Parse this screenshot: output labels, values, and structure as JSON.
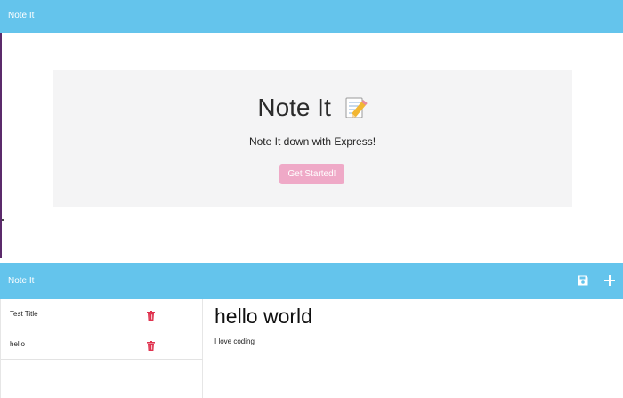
{
  "landing": {
    "brand": "Note It",
    "hero_title": "Note It",
    "hero_icon": "memo-pencil-icon",
    "subtitle": "Note It down with Express!",
    "cta_label": "Get Started!"
  },
  "app": {
    "brand": "Note It",
    "toolbar": {
      "save_icon": "save-icon",
      "new_note_icon": "plus-icon"
    },
    "notes": [
      {
        "title": "Test Title"
      },
      {
        "title": "hello"
      }
    ],
    "active_note": {
      "title": "hello world",
      "text": "I love coding"
    }
  },
  "colors": {
    "navbar": "#64c4ec",
    "jumbotron": "#f4f4f5",
    "cta": "#efa9c7",
    "trash": "#e0334f"
  }
}
